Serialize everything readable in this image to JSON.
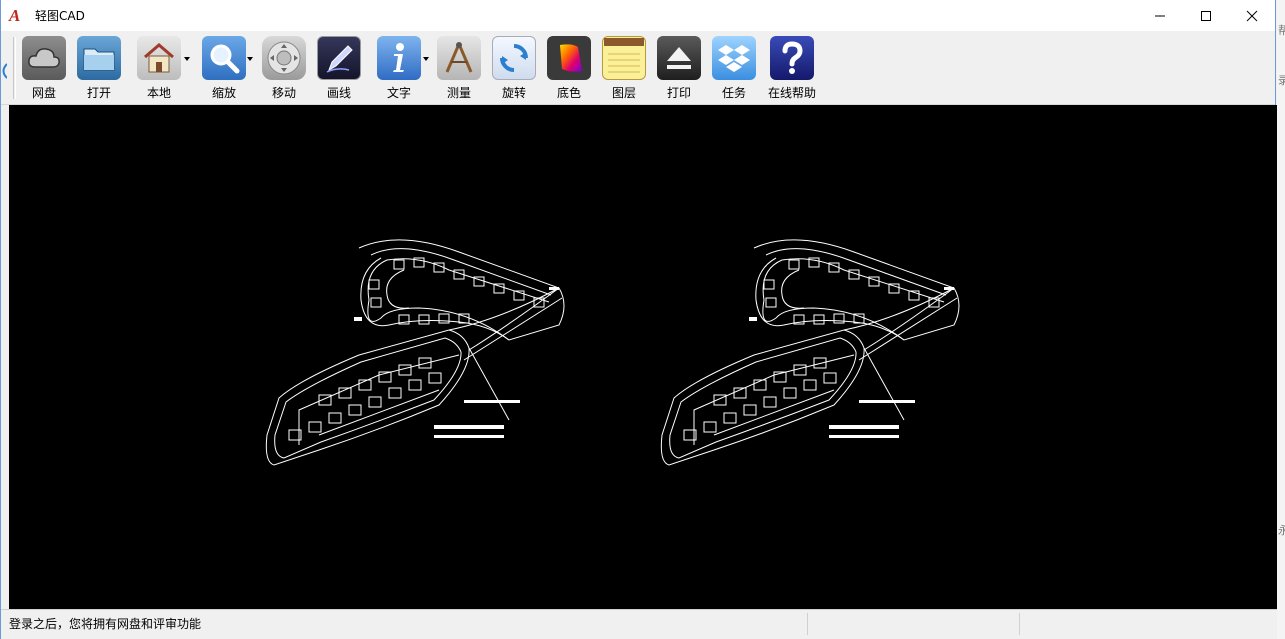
{
  "window": {
    "title": "轻图CAD",
    "logo_text": "A"
  },
  "toolbar": {
    "items": [
      {
        "id": "cloud",
        "label": "网盘",
        "icon": "cloud-icon"
      },
      {
        "id": "open",
        "label": "打开",
        "icon": "folder-icon"
      },
      {
        "id": "local",
        "label": "本地",
        "icon": "home-icon",
        "dropdown": true
      },
      {
        "id": "zoom",
        "label": "缩放",
        "icon": "magnifier-icon",
        "dropdown": true
      },
      {
        "id": "move",
        "label": "移动",
        "icon": "move-pad-icon"
      },
      {
        "id": "draw",
        "label": "画线",
        "icon": "pen-icon"
      },
      {
        "id": "text",
        "label": "文字",
        "icon": "info-icon",
        "dropdown": true
      },
      {
        "id": "measure",
        "label": "测量",
        "icon": "ruler-icon"
      },
      {
        "id": "rotate",
        "label": "旋转",
        "icon": "rotate-icon"
      },
      {
        "id": "bgcolor",
        "label": "底色",
        "icon": "color-palette-icon"
      },
      {
        "id": "layers",
        "label": "图层",
        "icon": "notepad-icon"
      },
      {
        "id": "print",
        "label": "打印",
        "icon": "eject-icon"
      },
      {
        "id": "tasks",
        "label": "任务",
        "icon": "dropbox-icon"
      },
      {
        "id": "help",
        "label": "在线帮助",
        "icon": "help-icon"
      }
    ]
  },
  "status": {
    "message": "登录之后，您将拥有网盘和评审功能"
  },
  "side_fragments": [
    "帮",
    "录",
    "永"
  ],
  "colors": {
    "canvas_bg": "#000000",
    "drawing_stroke": "#ffffff",
    "titlebar_bg": "#ffffff",
    "toolbar_bg": "#f0f0f0"
  }
}
